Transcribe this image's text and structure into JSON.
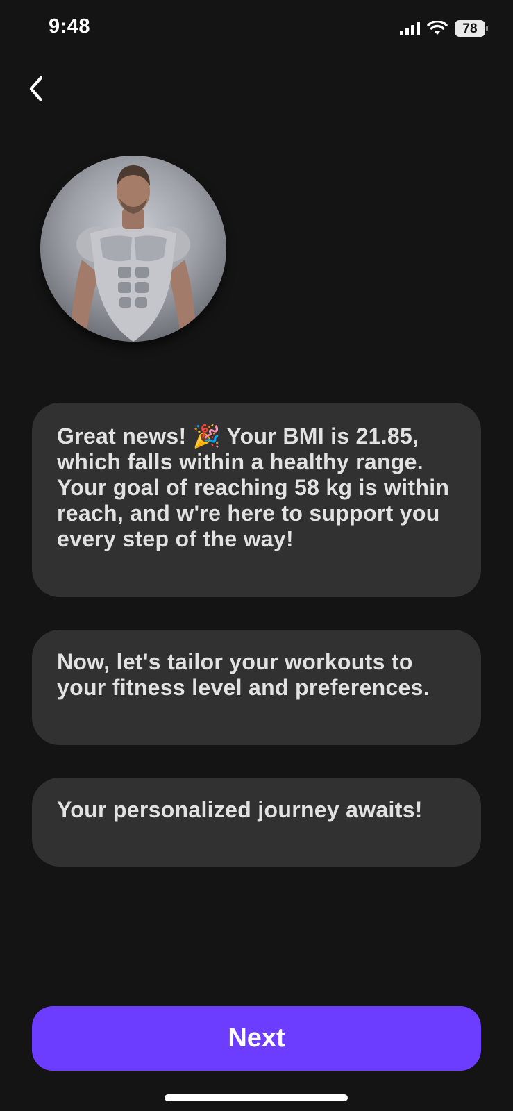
{
  "status_bar": {
    "time": "9:48",
    "battery": "78",
    "icons": [
      "signal-icon",
      "wifi-icon",
      "battery-icon"
    ]
  },
  "nav": {
    "back_icon": "chevron-left-icon"
  },
  "avatar": {
    "icon": "fitness-coach-avatar"
  },
  "messages": [
    {
      "text": "Great news! 🎉  Your BMI is 21.85, which falls within a healthy range. Your goal of reaching 58 kg is within reach, and w're here to support you every step of the way!"
    },
    {
      "text": " Now, let's tailor your workouts to your fitness level and preferences."
    },
    {
      "text": " Your personalized journey awaits!"
    }
  ],
  "next_button": {
    "label": "Next"
  },
  "colors": {
    "background": "#141414",
    "bubble": "#313131",
    "accent": "#6c3dff"
  }
}
